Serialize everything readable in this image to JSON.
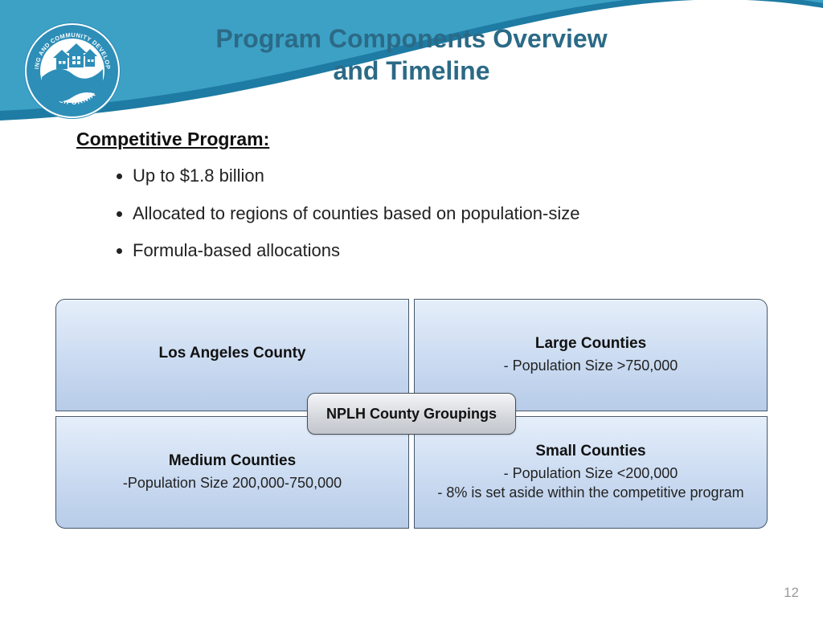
{
  "logo": {
    "outer_text_top": "HOUSING AND COMMUNITY DEVELOPMENT",
    "outer_text_bottom": "• CALIFORNIA •"
  },
  "title": {
    "line1": "Program Components Overview",
    "line2": "and Timeline"
  },
  "section_head": "Competitive Program:",
  "bullets": [
    "Up to $1.8 billion",
    "Allocated to regions of counties based on population-size",
    "Formula-based allocations"
  ],
  "quad": {
    "center": "NPLH County Groupings",
    "tl": {
      "title": "Los Angeles County",
      "lines": []
    },
    "tr": {
      "title": "Large Counties",
      "lines": [
        "- Population Size >750,000"
      ]
    },
    "bl": {
      "title": "Medium Counties",
      "lines": [
        "-Population Size 200,000-750,000"
      ]
    },
    "br": {
      "title": "Small Counties",
      "lines": [
        "- Population Size <200,000",
        "- 8% is set aside within the competitive program"
      ]
    }
  },
  "page_number": "12"
}
